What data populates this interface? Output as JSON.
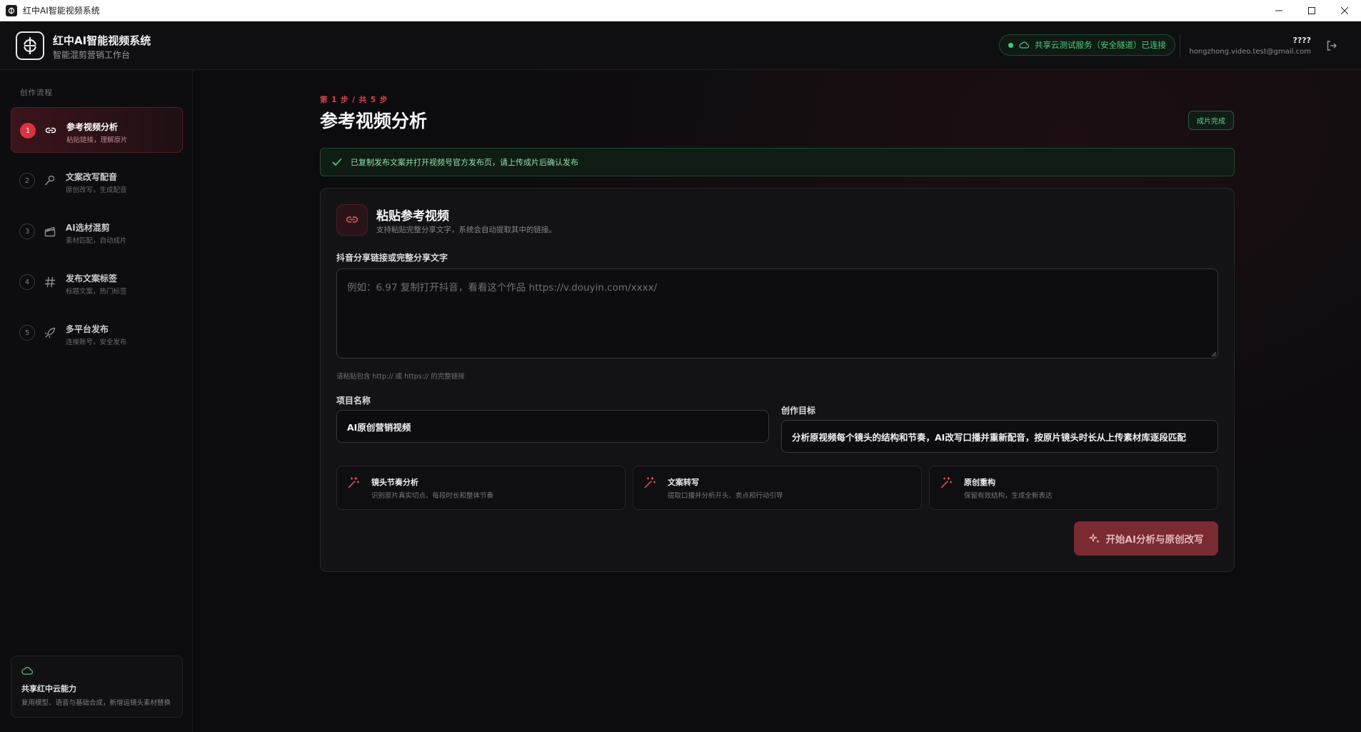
{
  "window": {
    "title": "红中AI智能视频系统"
  },
  "header": {
    "brand_title": "红中AI智能视频系统",
    "brand_subtitle": "智能混剪营销工作台",
    "cloud_status": "共享云测试服务（安全隧道）已连接",
    "user_name": "????",
    "user_email": "hongzhong.video.test@gmail.com"
  },
  "sidebar": {
    "section_title": "创作流程",
    "steps": [
      {
        "num": "1",
        "label": "参考视频分析",
        "sub": "粘贴链接，理解原片",
        "icon": "link-icon"
      },
      {
        "num": "2",
        "label": "文案改写配音",
        "sub": "原创改写，生成配音",
        "icon": "microphone-icon"
      },
      {
        "num": "3",
        "label": "AI选材混剪",
        "sub": "素材匹配，自动成片",
        "icon": "clapperboard-icon"
      },
      {
        "num": "4",
        "label": "发布文案标签",
        "sub": "标题文案，热门标签",
        "icon": "hash-icon"
      },
      {
        "num": "5",
        "label": "多平台发布",
        "sub": "连接账号，安全发布",
        "icon": "rocket-icon"
      }
    ],
    "cloud_card": {
      "title": "共享红中云能力",
      "desc": "复用模型、语音与基础合成，新增运镜头素材替换"
    }
  },
  "main": {
    "step_counter": "第 1 步 / 共 5 步",
    "page_title": "参考视频分析",
    "done_badge": "成片完成",
    "success_message": "已复制发布文案并打开视频号官方发布页，请上传成片后确认发布",
    "card": {
      "title": "粘贴参考视频",
      "subtitle": "支持粘贴完整分享文字，系统会自动提取其中的链接。",
      "link_label": "抖音分享链接或完整分享文字",
      "link_placeholder": "例如：6.97 复制打开抖音，看看这个作品 https://v.douyin.com/xxxx/",
      "link_hint": "请粘贴包含 http:// 或 https:// 的完整链接",
      "project_label": "项目名称",
      "project_value": "AI原创营销视频",
      "goal_label": "创作目标",
      "goal_value": "分析原视频每个镜头的结构和节奏，AI改写口播并重新配音，按原片镜头时长从上传素材库逐段匹配",
      "features": [
        {
          "title": "镜头节奏分析",
          "desc": "识别原片真实切点、每段时长和整体节奏"
        },
        {
          "title": "文案转写",
          "desc": "提取口播并分析开头、卖点和行动引导"
        },
        {
          "title": "原创重构",
          "desc": "保留有效结构，生成全新表达"
        }
      ],
      "start_button": "开始AI分析与原创改写"
    }
  },
  "colors": {
    "accent": "#d9343f",
    "success": "#4ecb7b",
    "background": "#0c0c0e"
  }
}
